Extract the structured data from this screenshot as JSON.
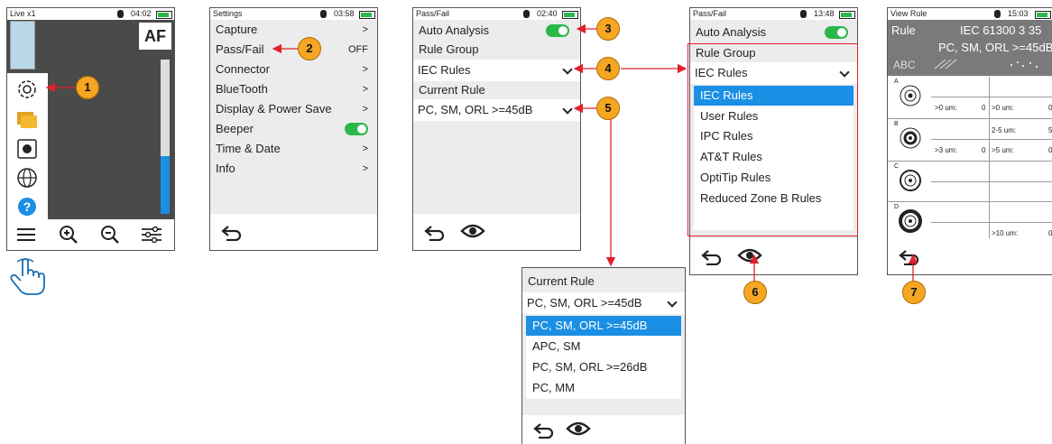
{
  "screen1": {
    "title": "Live x1",
    "time": "04:02",
    "af_label": "AF",
    "icons": [
      "settings-icon",
      "folder-icon",
      "record-icon",
      "globe-icon",
      "help-icon",
      "menu-icon",
      "zoom-in-icon",
      "zoom-out-icon",
      "sliders-icon",
      "hand-pointer-icon"
    ]
  },
  "screen2": {
    "title": "Settings",
    "time": "03:58",
    "items": [
      {
        "label": "Capture",
        "value": ">"
      },
      {
        "label": "Pass/Fail",
        "value": "OFF"
      },
      {
        "label": "Connector",
        "value": ">"
      },
      {
        "label": "BlueTooth",
        "value": ">"
      },
      {
        "label": "Display & Power Save",
        "value": ">"
      },
      {
        "label": "Beeper",
        "value": ""
      },
      {
        "label": "Time & Date",
        "value": ">"
      },
      {
        "label": "Info",
        "value": ">"
      }
    ]
  },
  "screen3": {
    "title": "Pass/Fail",
    "time": "02:40",
    "auto_analysis": "Auto Analysis",
    "rule_group_label": "Rule Group",
    "rule_group_value": "IEC Rules",
    "current_rule_label": "Current Rule",
    "current_rule_value": "PC, SM, ORL >=45dB"
  },
  "screen4": {
    "title": "Pass/Fail",
    "time": "13:48",
    "auto_analysis": "Auto Analysis",
    "rule_group_label": "Rule Group",
    "rule_group_value": "IEC Rules",
    "options": [
      "IEC Rules",
      "User Rules",
      "IPC Rules",
      "AT&T Rules",
      "OptiTip Rules",
      "Reduced Zone B Rules"
    ]
  },
  "screen5": {
    "title": "View Rule",
    "time": "15:03",
    "rule_label": "Rule",
    "rule_name": "IEC 61300 3 35",
    "rule_desc": "PC, SM, ORL >=45dB",
    "abc": "ABC",
    "zones": [
      {
        "letter": "A",
        "row1": [
          "",
          ""
        ],
        "row2": [
          ">0 um:",
          "0",
          ">0 um:",
          "0"
        ]
      },
      {
        "letter": "B",
        "row1": [
          "",
          "2-5 um:",
          "5"
        ],
        "row2": [
          ">3 um:",
          "0",
          ">5 um:",
          "0"
        ]
      },
      {
        "letter": "C",
        "row1": [
          "",
          ""
        ],
        "row2": [
          "",
          ""
        ]
      },
      {
        "letter": "D",
        "row1": [
          "",
          ""
        ],
        "row2": [
          "",
          ">10 um:",
          "0"
        ]
      }
    ]
  },
  "popup": {
    "current_rule_label": "Current Rule",
    "current_rule_value": "PC, SM, ORL >=45dB",
    "options": [
      "PC, SM, ORL >=45dB",
      "APC, SM",
      "PC, SM, ORL >=26dB",
      "PC, MM"
    ]
  },
  "callouts": [
    "1",
    "2",
    "3",
    "4",
    "5",
    "6",
    "7"
  ],
  "colors": {
    "accent": "#1a8fe3",
    "toggle": "#2bb84a",
    "callout": "#f5a623",
    "arrow": "#e0202a"
  }
}
